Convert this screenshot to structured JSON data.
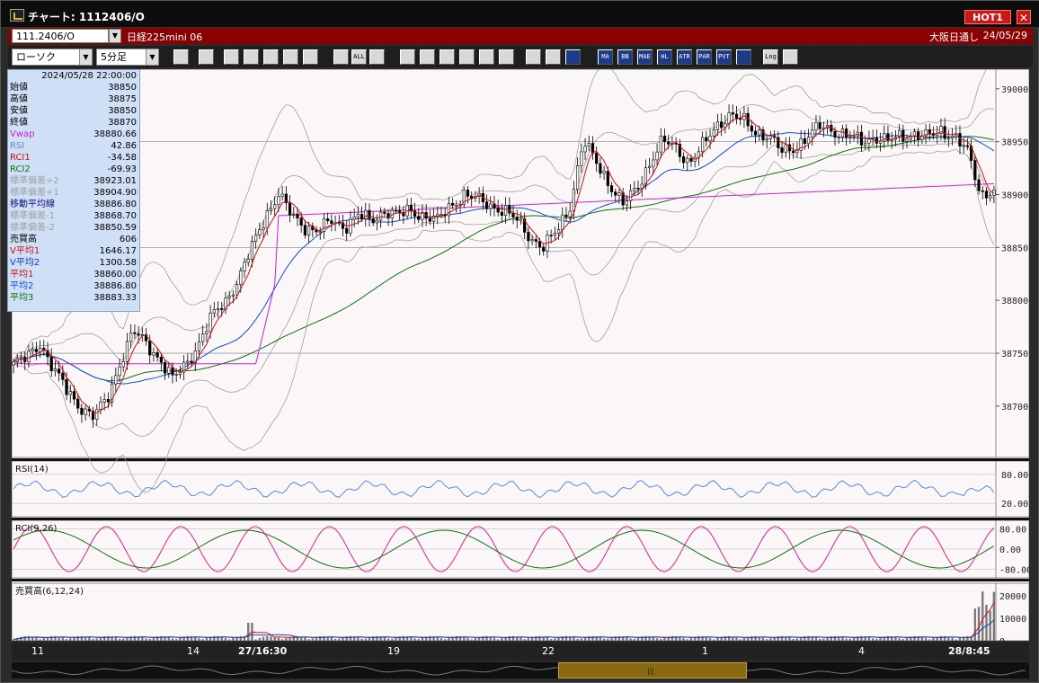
{
  "window": {
    "title": "チャート: 1112406/O",
    "hot_badge": "HOT1",
    "close": "✕"
  },
  "header": {
    "symbol": "111.2406/O",
    "contract": "日経225mini 06",
    "session": "大阪日通し",
    "date": "24/05/29"
  },
  "toolbar": {
    "chart_type": "ローソク",
    "interval": "5分足",
    "buttons": [
      "zoom",
      "bars",
      "sub1",
      "sub2",
      "sub3",
      "sub4",
      "candle1",
      "candle2",
      "ALL",
      "pen",
      "line",
      "cursor",
      "arrow",
      "note",
      "trash",
      "grid",
      "tool",
      "color",
      "ichimoku",
      "MA",
      "BB",
      "MAE",
      "HL",
      "ATR",
      "PAR",
      "PVT",
      "box",
      "Log",
      "exit"
    ]
  },
  "info": {
    "datetime": "2024/05/28 22:00:00",
    "rows": [
      {
        "label": "始値",
        "value": "38850",
        "color": "#000000"
      },
      {
        "label": "高値",
        "value": "38875",
        "color": "#000000"
      },
      {
        "label": "安値",
        "value": "38850",
        "color": "#000000"
      },
      {
        "label": "終値",
        "value": "38870",
        "color": "#000000"
      },
      {
        "label": "Vwap",
        "value": "38880.66",
        "color": "#d020d0"
      },
      {
        "label": "RSI",
        "value": "42.86",
        "color": "#5a8ad8"
      },
      {
        "label": "RCI1",
        "value": "-34.58",
        "color": "#d01010"
      },
      {
        "label": "RCI2",
        "value": "-69.93",
        "color": "#107010"
      },
      {
        "label": "標準偏差+2",
        "value": "38923.01",
        "color": "#a0a0a0"
      },
      {
        "label": "標準偏差+1",
        "value": "38904.90",
        "color": "#a0a0a0"
      },
      {
        "label": "移動平均線",
        "value": "38886.80",
        "color": "#101080"
      },
      {
        "label": "標準偏差-1",
        "value": "38868.70",
        "color": "#a0a0a0"
      },
      {
        "label": "標準偏差-2",
        "value": "38850.59",
        "color": "#a0a0a0"
      },
      {
        "label": "売買高",
        "value": "606",
        "color": "#000000"
      },
      {
        "label": "V平均1",
        "value": "1646.17",
        "color": "#d01010"
      },
      {
        "label": "V平均2",
        "value": "1300.58",
        "color": "#1040c0"
      },
      {
        "label": "平均1",
        "value": "38860.00",
        "color": "#d01010"
      },
      {
        "label": "平均2",
        "value": "38886.80",
        "color": "#1050d0"
      },
      {
        "label": "平均3",
        "value": "38883.33",
        "color": "#107010"
      }
    ]
  },
  "panels": {
    "rsi_label": "RSI(14)",
    "rci_label": "RCI(9,26)",
    "vol_label": "売買高(6,12,24)"
  },
  "axes": {
    "price_ticks": [
      "39000",
      "38950",
      "38900",
      "38850",
      "38800",
      "38750",
      "38700"
    ],
    "rsi_ticks": [
      "80.00",
      "20.00"
    ],
    "rci_ticks": [
      "80.00",
      "0.00",
      "-80.00"
    ],
    "vol_ticks": [
      "20000",
      "10000",
      "0"
    ],
    "x_ticks": [
      "11",
      "14",
      "27/16:30",
      "19",
      "22",
      "1",
      "4",
      "28/8:45"
    ]
  },
  "chart_data": {
    "type": "candlestick",
    "ylim": [
      38660,
      39010
    ],
    "colors": {
      "up": "#ffffff",
      "down": "#000000",
      "ma1": "#d01010",
      "ma2": "#1050d0",
      "ma3": "#107010",
      "vwap": "#d020d0",
      "band": "#a0a0a0"
    },
    "price_path": [
      38740,
      38745,
      38760,
      38735,
      38715,
      38700,
      38690,
      38705,
      38740,
      38770,
      38760,
      38745,
      38725,
      38740,
      38760,
      38785,
      38800,
      38820,
      38850,
      38880,
      38900,
      38880,
      38870,
      38865,
      38875,
      38870,
      38880,
      38875,
      38885,
      38880,
      38885,
      38880,
      38875,
      38890,
      38900,
      38895,
      38890,
      38885,
      38875,
      38860,
      38850,
      38865,
      38890,
      38950,
      38930,
      38910,
      38890,
      38905,
      38930,
      38950,
      38945,
      38930,
      38945,
      38965,
      38975,
      38970,
      38960,
      38955,
      38940,
      38945,
      38955,
      38965,
      38960,
      38955,
      38950,
      38955,
      38950,
      38955,
      38958,
      38954,
      38960,
      38956,
      38940,
      38900,
      38905
    ],
    "rsi_range": [
      0,
      100
    ],
    "rci_range": [
      -100,
      100
    ],
    "vol_range": [
      0,
      24000
    ]
  }
}
